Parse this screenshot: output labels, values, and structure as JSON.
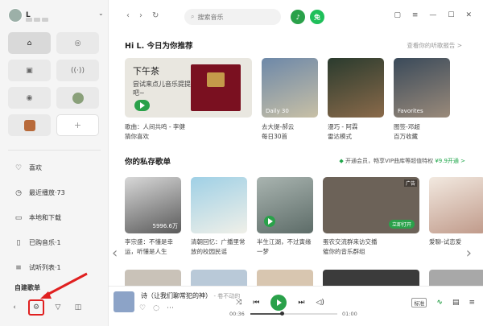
{
  "user": {
    "name": "L"
  },
  "search": {
    "placeholder": "搜索音乐"
  },
  "vip_badge": "免",
  "sidebar_menu": [
    {
      "label": "喜欢",
      "icon": "heart-icon"
    },
    {
      "label": "最近播放·73",
      "icon": "history-icon"
    },
    {
      "label": "本地和下载",
      "icon": "download-icon"
    },
    {
      "label": "已购音乐·1",
      "icon": "purchased-icon"
    },
    {
      "label": "试听列表·1",
      "icon": "list-icon"
    }
  ],
  "section_created": "自建歌单",
  "main": {
    "greeting": "Hi L. 今日为你推荐",
    "report_link": "查看你的听歌报告 >",
    "feature": {
      "title": "下午茶",
      "subtitle": "尝试来点儿音乐提提神吧~"
    },
    "row1_tags": [
      "Daily 30",
      "",
      "Favorites"
    ],
    "row1_captions": [
      [
        "歌曲：人间共鸣 - 李健",
        "猜你喜欢"
      ],
      [
        "去大提-郝云",
        "每日30首"
      ],
      [
        "漫巧 - 阿霖",
        "雷达模式"
      ],
      [
        "图签-邓超",
        "百万收藏"
      ]
    ],
    "private_title": "你的私存歌单",
    "vip_promo": "开通会员，畅享VIP曲库等超值特权",
    "vip_price": "¥9.9开通 >",
    "row2_plays": "5996.6万",
    "ad_label": "广告",
    "ad_cta": "立即打开",
    "row2_captions": [
      [
        "李宗盛：不懂是幸",
        "运，听懂是人生"
      ],
      [
        "清朝回忆：广播里常",
        "放的校园民谣"
      ],
      [
        "半生江湖，不过寅缘",
        "一梦"
      ],
      [
        "蛋农交流群来访交播",
        "催你的音乐群组"
      ],
      [
        "爱聊-试恋爱",
        ""
      ]
    ]
  },
  "player": {
    "title": "诗（让我们聊常犯的神）",
    "artist": "- 卷不动的",
    "time_current": "00:36",
    "time_total": "01:00",
    "progress": 0.36,
    "quality": "标准"
  },
  "colors": {
    "brand_green": "#2aa14a",
    "annotation_red": "#e02020"
  }
}
